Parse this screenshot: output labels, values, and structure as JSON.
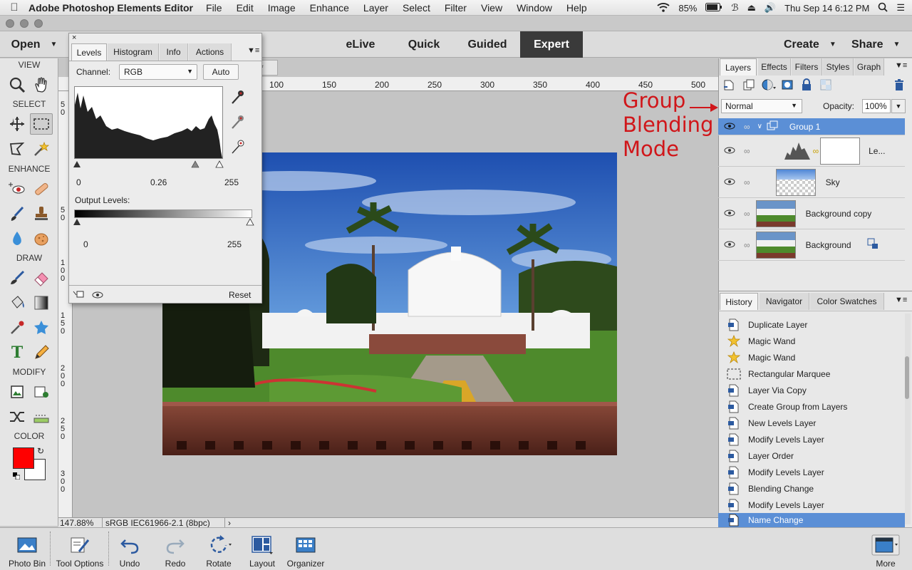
{
  "menubar": {
    "app_name": "Adobe Photoshop Elements Editor",
    "items": [
      "File",
      "Edit",
      "Image",
      "Enhance",
      "Layer",
      "Select",
      "Filter",
      "View",
      "Window",
      "Help"
    ],
    "battery": "85%",
    "datetime": "Thu Sep 14  6:12 PM"
  },
  "modebar": {
    "open_label": "Open",
    "modes": [
      "eLive",
      "Quick",
      "Guided",
      "Expert"
    ],
    "active_mode": "Expert",
    "create_label": "Create",
    "share_label": "Share"
  },
  "toolbox": {
    "sections": [
      "VIEW",
      "SELECT",
      "ENHANCE",
      "DRAW",
      "MODIFY",
      "COLOR"
    ],
    "foreground_color": "#ff0000",
    "background_color": "#ffffff"
  },
  "document": {
    "tab_suffix": "*",
    "zoom": "147.88%",
    "profile": "sRGB IEC61966-2.1 (8bpc)",
    "ruler_top": [
      "100",
      "150",
      "200",
      "250",
      "300",
      "350",
      "400",
      "450",
      "500"
    ],
    "ruler_left": [
      "5\n0",
      "5\n0",
      "1\n0\n0",
      "1\n5\n0",
      "2\n0\n0",
      "2\n5\n0",
      "3\n0\n0"
    ]
  },
  "levels": {
    "tabs": [
      "Levels",
      "Histogram",
      "Info",
      "Actions"
    ],
    "active_tab": "Levels",
    "channel_label": "Channel:",
    "channel_value": "RGB",
    "auto_label": "Auto",
    "input_black": "0",
    "input_mid": "0.26",
    "input_white": "255",
    "output_label": "Output Levels:",
    "output_black": "0",
    "output_white": "255",
    "reset_label": "Reset"
  },
  "layers_panel": {
    "tabs": [
      "Layers",
      "Effects",
      "Filters",
      "Styles",
      "Graph"
    ],
    "active_tab": "Layers",
    "blend_mode": "Normal",
    "opacity_label": "Opacity:",
    "opacity_value": "100%",
    "layers": [
      {
        "name": "Group 1",
        "selected": true
      },
      {
        "name": "Le..."
      },
      {
        "name": "Sky"
      },
      {
        "name": "Background copy"
      },
      {
        "name": "Background"
      }
    ]
  },
  "history_panel": {
    "tabs": [
      "History",
      "Navigator",
      "Color Swatches"
    ],
    "active_tab": "History",
    "items": [
      "Duplicate Layer",
      "Magic Wand",
      "Magic Wand",
      "Rectangular Marquee",
      "Layer Via Copy",
      "Create Group from Layers",
      "New Levels Layer",
      "Modify Levels Layer",
      "Layer Order",
      "Modify Levels Layer",
      "Blending Change",
      "Modify Levels Layer",
      "Name Change"
    ],
    "selected_index": 12
  },
  "annotation": {
    "line1": "Group",
    "line2": "Blending",
    "line3": "Mode"
  },
  "bottombar": {
    "items": [
      "Photo Bin",
      "Tool Options",
      "Undo",
      "Redo",
      "Rotate",
      "Layout",
      "Organizer"
    ],
    "more_label": "More"
  },
  "colors": {
    "accent_blue": "#5b8fd6",
    "annotation_red": "#d0161a"
  }
}
